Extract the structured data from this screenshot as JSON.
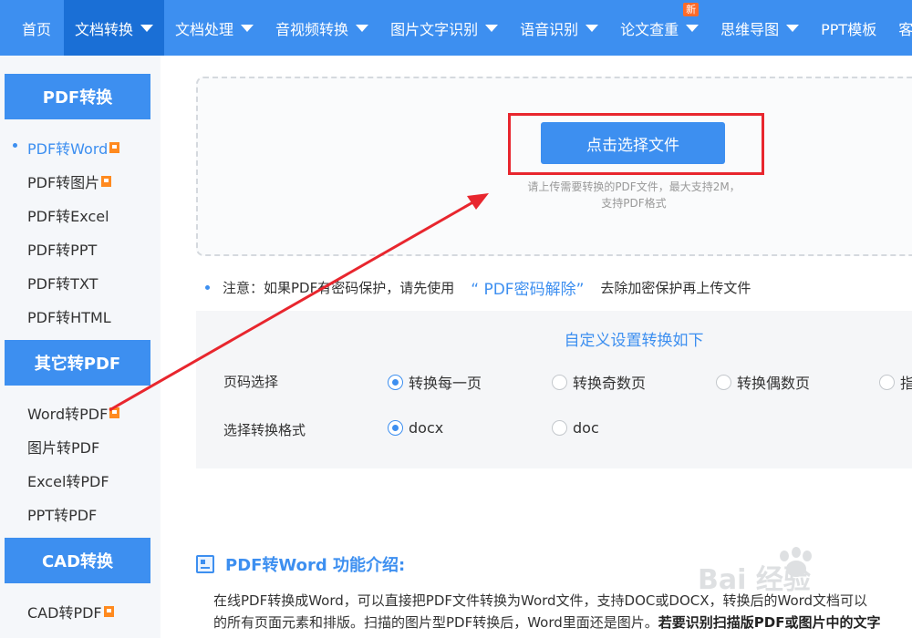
{
  "topnav": {
    "items": [
      {
        "label": "首页",
        "caret": false
      },
      {
        "label": "文档转换",
        "caret": true
      },
      {
        "label": "文档处理",
        "caret": true
      },
      {
        "label": "音视频转换",
        "caret": true
      },
      {
        "label": "图片文字识别",
        "caret": true
      },
      {
        "label": "语音识别",
        "caret": true
      },
      {
        "label": "论文查重",
        "caret": true
      },
      {
        "label": "思维导图",
        "caret": true
      },
      {
        "label": "PPT模板",
        "caret": false
      },
      {
        "label": "客",
        "caret": false
      }
    ],
    "new_badge": "新"
  },
  "sidebar": {
    "group1": {
      "title": "PDF转换",
      "items": [
        "PDF转Word",
        "PDF转图片",
        "PDF转Excel",
        "PDF转PPT",
        "PDF转TXT",
        "PDF转HTML"
      ]
    },
    "group2": {
      "title": "其它转PDF",
      "items": [
        "Word转PDF",
        "图片转PDF",
        "Excel转PDF",
        "PPT转PDF"
      ]
    },
    "group3": {
      "title": "CAD转换",
      "items": [
        "CAD转PDF"
      ]
    }
  },
  "upload": {
    "button_label": "点击选择文件",
    "hint_line1": "请上传需要转换的PDF文件，最大支持2M，",
    "hint_line2": "支持PDF格式"
  },
  "notice": {
    "prefix": "注意：如果PDF有密码保护，请先使用",
    "link": "“ PDF密码解除”",
    "suffix": "去除加密保护再上传文件"
  },
  "settings": {
    "title": "自定义设置转换如下",
    "page_label": "页码选择",
    "page_options": [
      "转换每一页",
      "转换奇数页",
      "转换偶数页",
      "指"
    ],
    "format_label": "选择转换格式",
    "format_options": [
      "docx",
      "doc"
    ]
  },
  "intro": {
    "title": "PDF转Word 功能介绍:",
    "line1": "在线PDF转换成Word，可以直接把PDF文件转换为Word文件，支持DOC或DOCX，转换后的Word文档可以",
    "line2_normal": "的所有页面元素和排版。扫描的图片型PDF转换后，Word里面还是图片。",
    "line2_bold": "若要识别扫描版PDF或图片中的文字"
  },
  "watermark": {
    "text": "Bai 经验"
  },
  "colors": {
    "brand": "#3d8ff0",
    "active_nav": "#1a6fd6",
    "highlight": "#e8262e",
    "badge": "#ff6b2a"
  }
}
